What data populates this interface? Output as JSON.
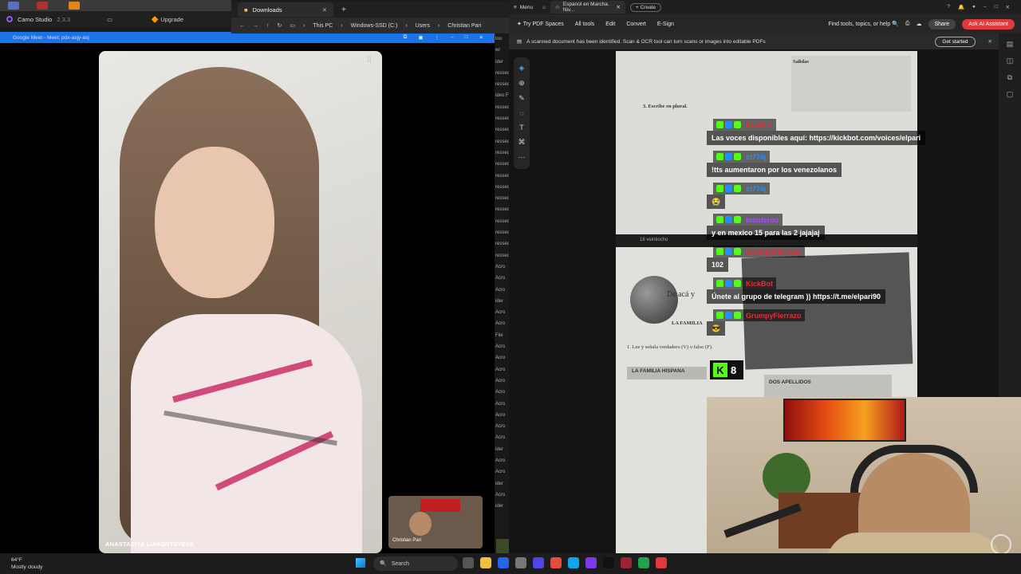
{
  "camo": {
    "title": "Camo Studio",
    "version": "2.3.3",
    "upgrade": "Upgrade"
  },
  "explorer": {
    "tab": "Downloads",
    "breadcrumbs": [
      "This PC",
      "Windows-SSD (C:)",
      "Users",
      "Christian Pari"
    ],
    "list": [
      "loo",
      "wi",
      "ider",
      "ressed",
      "ressed",
      "ideo F",
      "ressed",
      "ressed",
      "ressed",
      "ressed",
      "ressed",
      "ressed",
      "ressed",
      "ressed",
      "ressed",
      "ressed",
      "ressed",
      "ressed",
      "ressed",
      "ressed",
      "Acro",
      "Acro",
      "Acro",
      "ider",
      "Acro",
      "Acro",
      "File",
      "Acro",
      "Acro",
      "Acro",
      "Acro",
      "Acro",
      "Acro",
      "Acro",
      "Acro",
      "Acro",
      "ider",
      "Acro",
      "Acro",
      "ider",
      "Acro",
      "ider"
    ]
  },
  "meet": {
    "bar_title": "Google Meet - Meet: pdx-asjy-asj",
    "participant_name": "ANASTASIYA LIAVONTSYEVA",
    "self_name": "Christian Pari"
  },
  "acrobat": {
    "menu": "Menu",
    "tab_title": "Espanol en Marcha. Niv...",
    "create": "Create",
    "toolbar": [
      "Try PDF Spaces",
      "All tools",
      "Edit",
      "Convert",
      "E-Sign"
    ],
    "find": "Find tools, topics, or help",
    "share": "Share",
    "ai": "Ask AI Assistant",
    "scan_msg": "A scanned document has been identified. Scan & OCR tool can turn scans or images into editable PDFs",
    "get_started": "Get started"
  },
  "page_text": {
    "salidas": "Salidas",
    "plural": "3. Escribe en plural.",
    "footer": "18  veintiocho",
    "familia": "LA FAMILIA",
    "leey": "1. Lee y señala verdadero (V) o falso (F).",
    "familia_hispana": "LA FAMILIA HISPANA",
    "dos_apellidos": "DOS APELLIDOS",
    "deaca": "De acá y"
  },
  "chat": [
    {
      "user": "KickBot",
      "color": "#e0303a",
      "msg": "Las voces disponibles aquí: https://kickbot.com/voices/elpari"
    },
    {
      "user": "st776j",
      "color": "#1f8fff",
      "msg": "!tts aumentaron por los venezolanos"
    },
    {
      "user": "st776j",
      "color": "#1f8fff",
      "msg": "😭"
    },
    {
      "user": "monterou",
      "color": "#a34bff",
      "msg": "y en mexico 15 para las 2 jajajaj"
    },
    {
      "user": "GrumpyFierrazo",
      "color": "#e0303a",
      "msg": "102"
    },
    {
      "user": "KickBot",
      "color": "#e0303a",
      "msg": "Únete al grupo de telegram )) https://t.me/elpari90"
    },
    {
      "user": "GrumpyFierrazo",
      "color": "#e0303a",
      "msg": "😎"
    }
  ],
  "viewers": "8",
  "taskbar": {
    "temp": "64°F",
    "weather": "Mostly cloudy",
    "search": "Search"
  },
  "colors": {
    "kick_green": "#53fc18",
    "meet_blue": "#1a73e8",
    "acrobat_red": "#e03a3e"
  }
}
